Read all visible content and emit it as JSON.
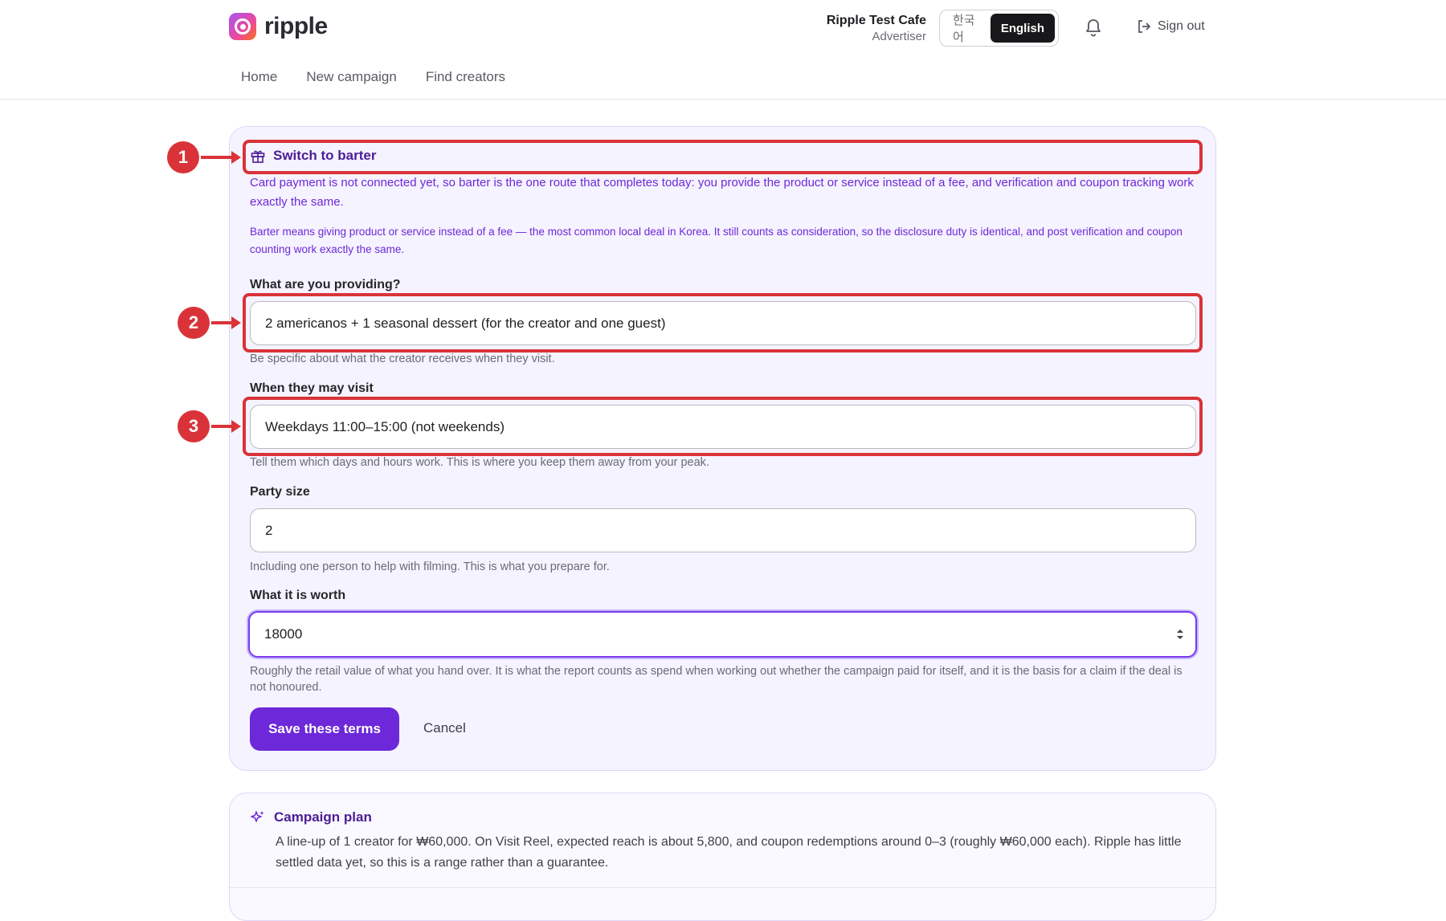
{
  "brand": {
    "name": "ripple"
  },
  "nav": [
    "Home",
    "New campaign",
    "Find creators"
  ],
  "account": {
    "name": "Ripple Test Cafe",
    "role": "Advertiser"
  },
  "language": {
    "options": [
      "한국어",
      "English"
    ],
    "selected": "English"
  },
  "header": {
    "sign_out": "Sign out",
    "icons": {
      "notifications": "bell-icon",
      "sign_out": "sign-out-icon"
    }
  },
  "barter": {
    "title": "Switch to barter",
    "icon": "gift-icon",
    "note1": "Card payment is not connected yet, so barter is the one route that completes today: you provide the product or service instead of a fee, and verification and coupon tracking work exactly the same.",
    "note2": "Barter means giving product or service instead of a fee — the most common local deal in Korea. It still counts as consideration, so the disclosure duty is identical, and post verification and coupon counting work exactly the same.",
    "fields": [
      {
        "label": "What are you providing?",
        "value": "2 americanos + 1 seasonal dessert (for the creator and one guest)",
        "help": "Be specific about what the creator receives when they visit."
      },
      {
        "label": "When they may visit",
        "value": "Weekdays 11:00–15:00 (not weekends)",
        "help": "Tell them which days and hours work. This is where you keep them away from your peak."
      },
      {
        "label": "Party size",
        "value": "2",
        "help": "Including one person to help with filming. This is what you prepare for."
      },
      {
        "label": "What it is worth",
        "value": "18000",
        "help": "Roughly the retail value of what you hand over. It is what the report counts as spend when working out whether the campaign paid for itself, and it is the basis for a claim if the deal is not honoured."
      }
    ],
    "save_label": "Save these terms",
    "cancel_label": "Cancel"
  },
  "plan": {
    "title": "Campaign plan",
    "icon": "sparkle-icon",
    "text": "A line-up of 1 creator for ₩60,000. On Visit Reel, expected reach is about 5,800, and coupon redemptions around 0–3 (roughly ₩60,000 each). Ripple has little settled data yet, so this is a range rather than a guarantee."
  },
  "annotations": [
    "1",
    "2",
    "3"
  ],
  "colors": {
    "accent": "#6d28d9",
    "annotation": "#d93339",
    "card_bg": "#f5f3ff"
  }
}
